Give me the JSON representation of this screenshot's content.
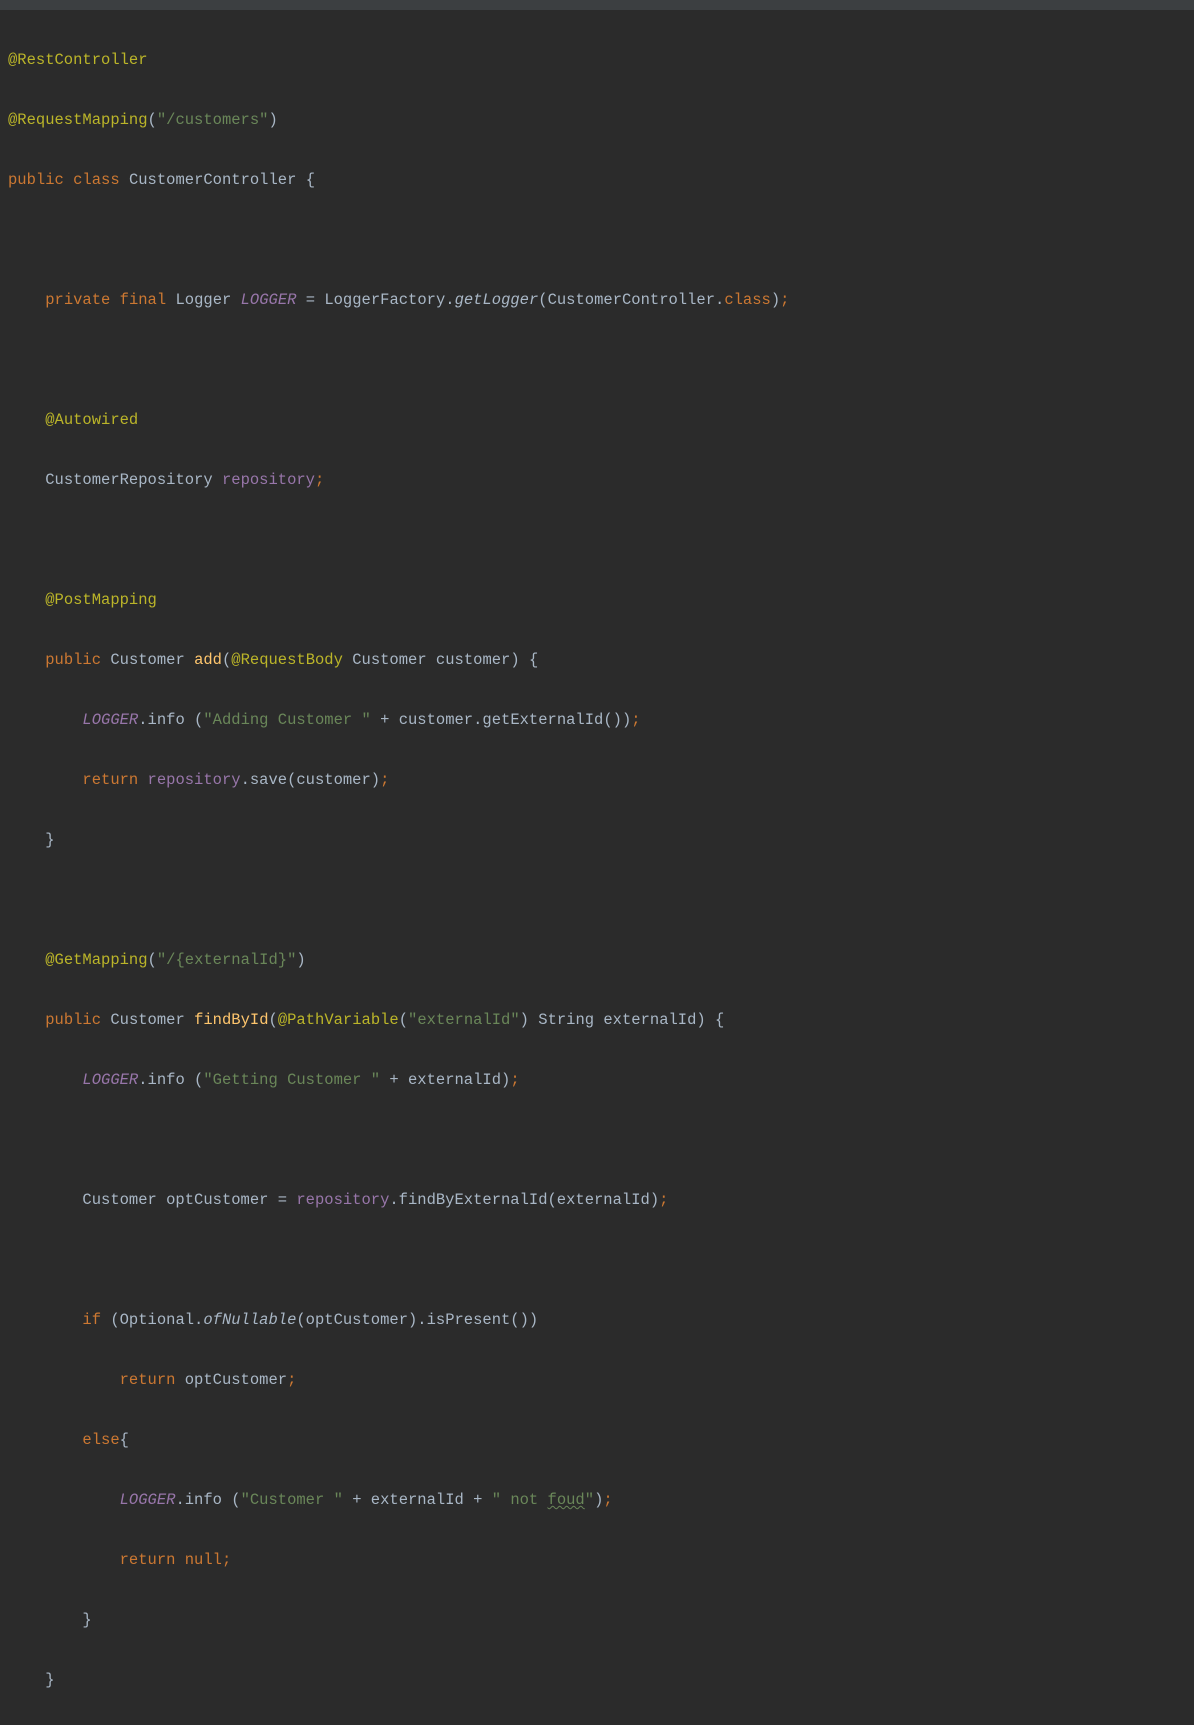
{
  "code": {
    "l1_anno": "@RestController",
    "l2_anno": "@RequestMapping",
    "l2_str": "\"/customers\"",
    "l3_kw1": "public",
    "l3_kw2": "class",
    "l3_cls": "CustomerController",
    "l3_brace": " {",
    "l5_kw1": "private",
    "l5_kw2": "final",
    "l5_type": "Logger",
    "l5_field": "LOGGER",
    "l5_eq": " = ",
    "l5_fac": "LoggerFactory.",
    "l5_getlog": "getLogger",
    "l5_rest": "(CustomerController.",
    "l5_kw3": "class",
    "l5_end": ")",
    "l5_semi": ";",
    "l7_anno": "@Autowired",
    "l8_type": "CustomerRepository",
    "l8_field": "repository",
    "l8_semi": ";",
    "l10_anno": "@PostMapping",
    "l11_kw": "public",
    "l11_type": "Customer",
    "l11_meth": "add",
    "l11_open": "(",
    "l11_anno": "@RequestBody",
    "l11_param": " Customer customer) {",
    "l12_field": "LOGGER",
    "l12_call": ".info (",
    "l12_str": "\"Adding Customer \"",
    "l12_rest": " + customer.getExternalId())",
    "l12_semi": ";",
    "l13_kw": "return",
    "l13_field": "repository",
    "l13_rest": ".save(customer)",
    "l13_semi": ";",
    "l14_brace": "}",
    "l16_anno": "@GetMapping",
    "l16_open": "(",
    "l16_str": "\"/{externalId}\"",
    "l16_close": ")",
    "l17_kw": "public",
    "l17_type": "Customer",
    "l17_meth": "findById",
    "l17_open": "(",
    "l17_anno": "@PathVariable",
    "l17_popen": "(",
    "l17_str": "\"externalId\"",
    "l17_rest": ") String externalId) {",
    "l18_field": "LOGGER",
    "l18_call": ".info (",
    "l18_str": "\"Getting Customer \"",
    "l18_rest": " + externalId)",
    "l18_semi": ";",
    "l20_pre": "Customer optCustomer = ",
    "l20_field": "repository",
    "l20_rest": ".findByExternalId(externalId)",
    "l20_semi": ";",
    "l22_kw": "if",
    "l22_rest1": " (Optional.",
    "l22_ofn": "ofNullable",
    "l22_rest2": "(optCustomer).isPresent())",
    "l23_kw": "return",
    "l23_rest": " optCustomer",
    "l23_semi": ";",
    "l24_kw": "else",
    "l24_brace": "{",
    "l25_field": "LOGGER",
    "l25_call": ".info (",
    "l25_str1": "\"Customer \"",
    "l25_mid": " + externalId + ",
    "l25_str2a": "\" not ",
    "l25_typo": "foud",
    "l25_str2b": "\"",
    "l25_close": ")",
    "l25_semi": ";",
    "l26_kw": "return",
    "l26_null": "null",
    "l26_semi": ";",
    "l27_brace": "}",
    "l28_brace": "}"
  }
}
